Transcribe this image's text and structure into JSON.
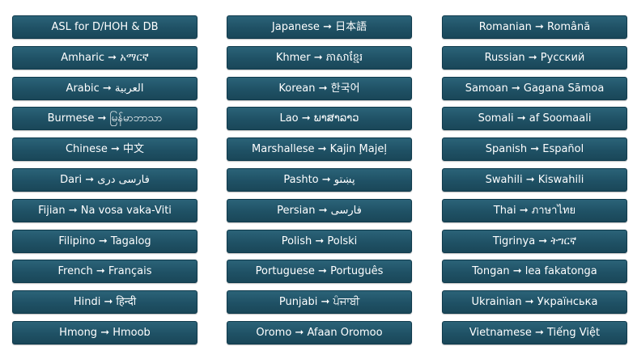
{
  "columns": [
    {
      "items": [
        {
          "label": "ASL for D/HOH & DB"
        },
        {
          "label": "Amharic ➞ አማርኛ"
        },
        {
          "label": "Arabic ➞ العربية"
        },
        {
          "label": "Burmese ➞ မြန်မာဘာသာ"
        },
        {
          "label": "Chinese ➞ 中文"
        },
        {
          "label": "Dari ➞ فارسی دری"
        },
        {
          "label": "Fijian ➞ Na vosa vaka-Viti"
        },
        {
          "label": "Filipino ➞ Tagalog"
        },
        {
          "label": "French ➞ Français"
        },
        {
          "label": "Hindi ➞ हिन्दी"
        },
        {
          "label": "Hmong ➞ Hmoob"
        }
      ]
    },
    {
      "items": [
        {
          "label": "Japanese ➞ 日本語"
        },
        {
          "label": "Khmer ➞ ភាសាខ្មែរ"
        },
        {
          "label": "Korean ➞ 한국어"
        },
        {
          "label": "Lao ➞ ພາສາລາວ"
        },
        {
          "label": "Marshallese ➞ Kajin M̧ajeļ"
        },
        {
          "label": "Pashto ➞ پښتو"
        },
        {
          "label": "Persian ➞ فارسی"
        },
        {
          "label": "Polish ➞ Polski"
        },
        {
          "label": "Portuguese ➞ Português"
        },
        {
          "label": "Punjabi ➞ ਪੰਜਾਬੀ"
        },
        {
          "label": "Oromo ➞ Afaan Oromoo"
        }
      ]
    },
    {
      "items": [
        {
          "label": "Romanian ➞ Română"
        },
        {
          "label": "Russian ➞ Русский"
        },
        {
          "label": "Samoan ➞ Gagana Sāmoa"
        },
        {
          "label": "Somali ➞ af Soomaali"
        },
        {
          "label": "Spanish ➞ Español"
        },
        {
          "label": "Swahili ➞ Kiswahili"
        },
        {
          "label": "Thai ➞ ภาษาไทย"
        },
        {
          "label": "Tigrinya ➞ ትግርኛ"
        },
        {
          "label": "Tongan ➞ lea fakatonga"
        },
        {
          "label": "Ukrainian ➞ Українська"
        },
        {
          "label": "Vietnamese ➞ Tiếng Việt"
        }
      ]
    }
  ],
  "colors": {
    "button_bg": "#1f5165",
    "button_text": "#ffffff",
    "page_bg": "#ffffff"
  }
}
